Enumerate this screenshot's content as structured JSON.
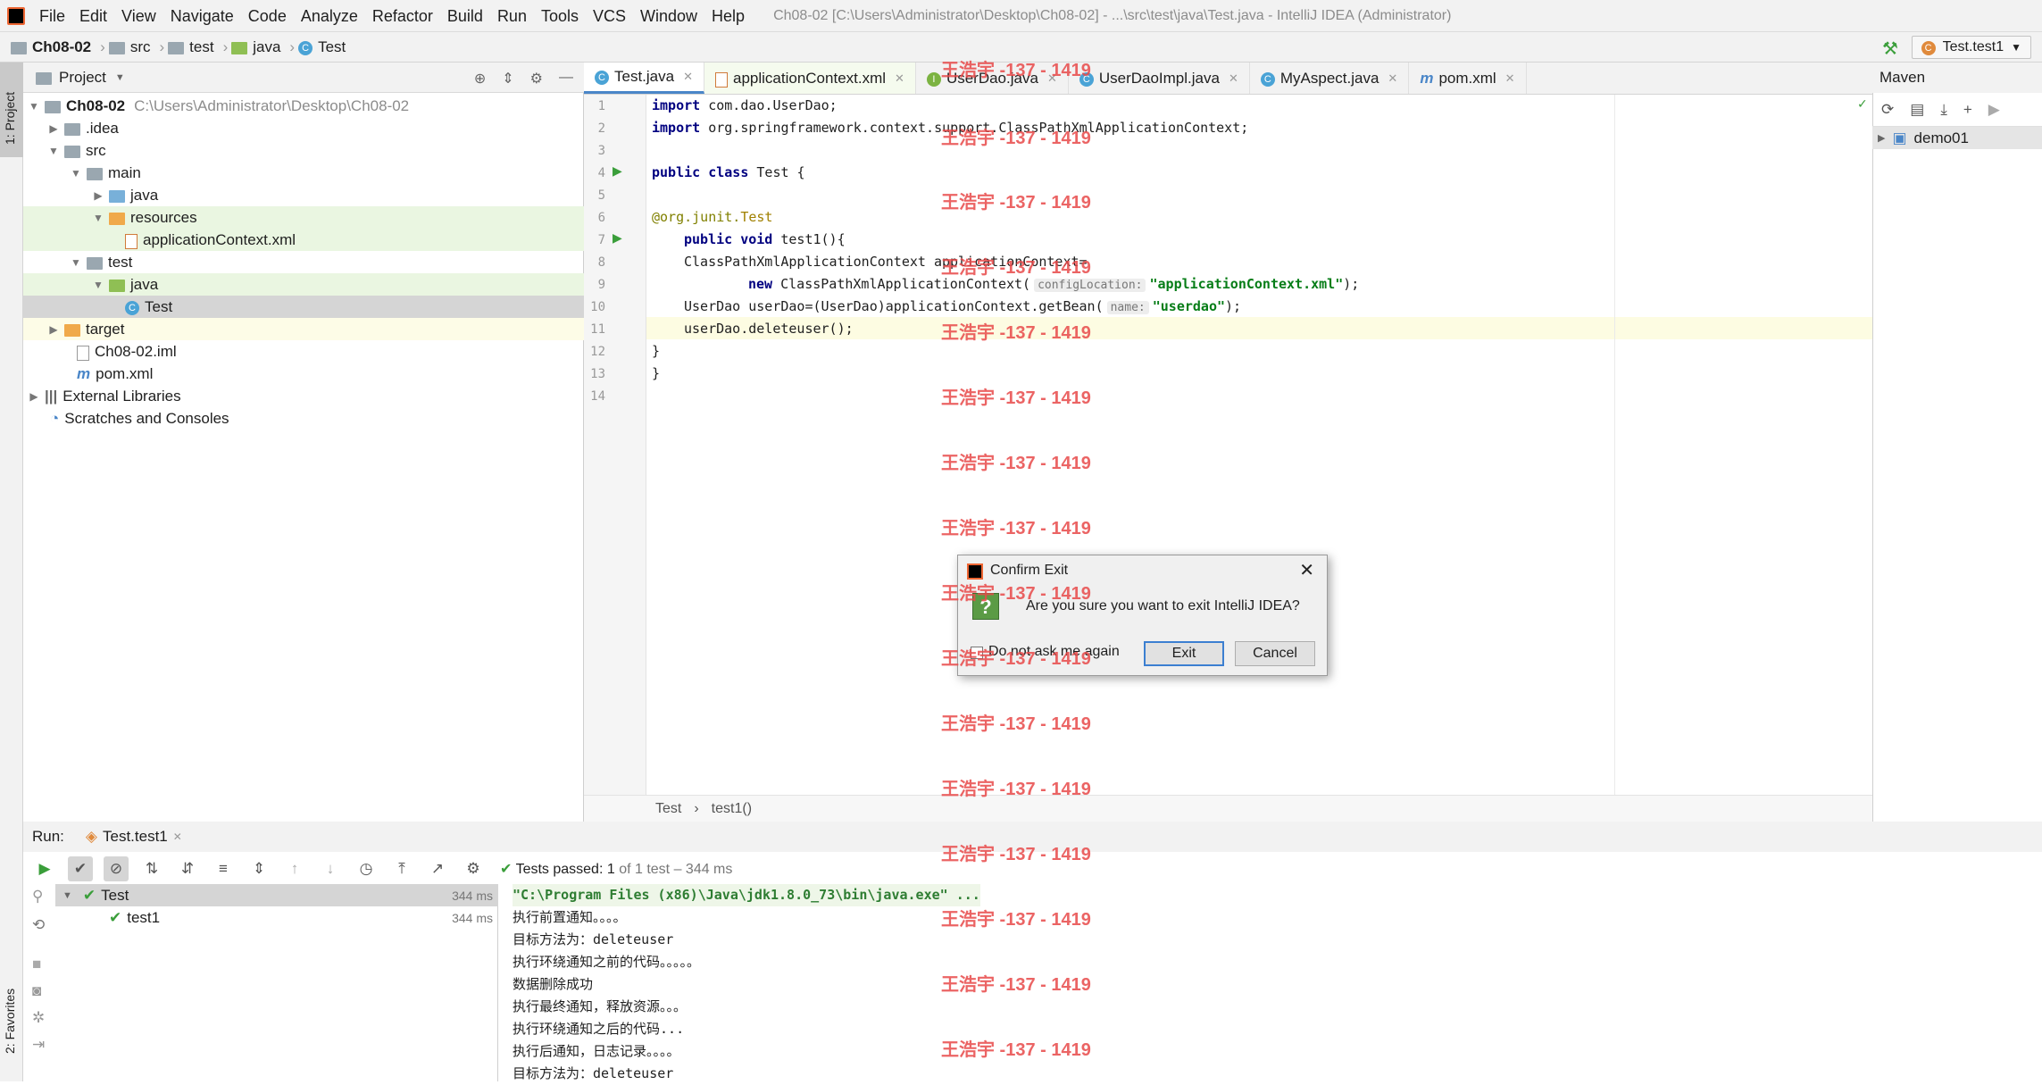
{
  "menu": [
    "File",
    "Edit",
    "View",
    "Navigate",
    "Code",
    "Analyze",
    "Refactor",
    "Build",
    "Run",
    "Tools",
    "VCS",
    "Window",
    "Help"
  ],
  "window_title": "Ch08-02 [C:\\Users\\Administrator\\Desktop\\Ch08-02] - ...\\src\\test\\java\\Test.java - IntelliJ IDEA (Administrator)",
  "breadcrumb": [
    "Ch08-02",
    "src",
    "test",
    "java",
    "Test"
  ],
  "run_config": "Test.test1",
  "left_tabs": {
    "project": "1: Project",
    "favorites": "2: Favorites"
  },
  "project": {
    "header": "Project",
    "rows": [
      {
        "label": "Ch08-02",
        "path": "C:\\Users\\Administrator\\Desktop\\Ch08-02"
      },
      {
        "label": ".idea"
      },
      {
        "label": "src"
      },
      {
        "label": "main"
      },
      {
        "label": "java"
      },
      {
        "label": "resources"
      },
      {
        "label": "applicationContext.xml"
      },
      {
        "label": "test"
      },
      {
        "label": "java"
      },
      {
        "label": "Test"
      },
      {
        "label": "target"
      },
      {
        "label": "Ch08-02.iml"
      },
      {
        "label": "pom.xml"
      },
      {
        "label": "External Libraries"
      },
      {
        "label": "Scratches and Consoles"
      }
    ]
  },
  "editor_tabs": [
    "Test.java",
    "applicationContext.xml",
    "UserDao.java",
    "UserDaoImpl.java",
    "MyAspect.java",
    "pom.xml"
  ],
  "code": {
    "l1_kw": "import",
    "l1_rest": " com.dao.UserDao;",
    "l2_kw": "import",
    "l2_rest": " org.springframework.context.support.ClassPathXmlApplicationContext;",
    "l4_kw": "public class",
    "l4_rest": " Test {",
    "l6_at": "@org.junit.",
    "l6_ann": "Test",
    "l7_kw": "public void",
    "l7_rest": " test1(){",
    "l8": "ClassPathXmlApplicationContext applicationContext=",
    "l9_kw": "new",
    "l9_rest": " ClassPathXmlApplicationContext(",
    "l9_hint": "configLocation:",
    "l9_str": "\"applicationContext.xml\"",
    "l9_end": ");",
    "l10": "UserDao userDao=(UserDao)applicationContext.getBean(",
    "l10_hint": "name:",
    "l10_str": "\"userdao\"",
    "l10_end": ");",
    "l11": "userDao.deleteuser();",
    "l12": "}",
    "l13": "}"
  },
  "line_numbers": [
    "1",
    "2",
    "3",
    "4",
    "5",
    "6",
    "7",
    "8",
    "9",
    "10",
    "11",
    "12",
    "13",
    "14"
  ],
  "editor_breadcrumb": [
    "Test",
    "test1()"
  ],
  "maven": {
    "title": "Maven",
    "project": "demo01"
  },
  "run": {
    "label": "Run:",
    "tab": "Test.test1",
    "status_prefix": "Tests passed:",
    "status_count": "1",
    "status_rest": "of 1 test – 344 ms",
    "tests": [
      {
        "name": "Test",
        "time": "344 ms"
      },
      {
        "name": "test1",
        "time": "344 ms"
      }
    ],
    "console": [
      "\"C:\\Program Files (x86)\\Java\\jdk1.8.0_73\\bin\\java.exe\" ...",
      "执行前置通知。。。。",
      "目标方法为：deleteuser",
      "执行环绕通知之前的代码。。。。。",
      "数据删除成功",
      "执行最终通知，释放资源。。。",
      "执行环绕通知之后的代码...",
      "执行后通知，日志记录。。。。",
      "目标方法为：deleteuser"
    ]
  },
  "dialog": {
    "title": "Confirm Exit",
    "message": "Are you sure you want to exit IntelliJ IDEA?",
    "checkbox": "Do not ask me again",
    "ok": "Exit",
    "cancel": "Cancel"
  },
  "watermark": "王浩宇 -137 - 1419",
  "colors": {
    "accent": "#4a86c8",
    "keyword": "#000080",
    "string": "#067d17",
    "watermark": "#e84a4a",
    "success": "#3a9e3a"
  }
}
